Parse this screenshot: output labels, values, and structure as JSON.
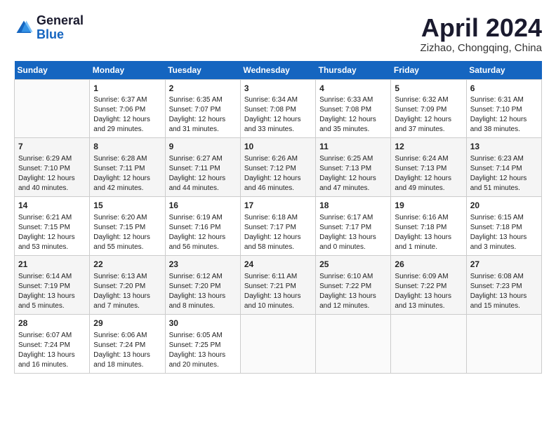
{
  "header": {
    "logo_general": "General",
    "logo_blue": "Blue",
    "title": "April 2024",
    "location": "Zizhao, Chongqing, China"
  },
  "calendar": {
    "days_of_week": [
      "Sunday",
      "Monday",
      "Tuesday",
      "Wednesday",
      "Thursday",
      "Friday",
      "Saturday"
    ],
    "weeks": [
      [
        {
          "day": "",
          "data": ""
        },
        {
          "day": "1",
          "data": "Sunrise: 6:37 AM\nSunset: 7:06 PM\nDaylight: 12 hours\nand 29 minutes."
        },
        {
          "day": "2",
          "data": "Sunrise: 6:35 AM\nSunset: 7:07 PM\nDaylight: 12 hours\nand 31 minutes."
        },
        {
          "day": "3",
          "data": "Sunrise: 6:34 AM\nSunset: 7:08 PM\nDaylight: 12 hours\nand 33 minutes."
        },
        {
          "day": "4",
          "data": "Sunrise: 6:33 AM\nSunset: 7:08 PM\nDaylight: 12 hours\nand 35 minutes."
        },
        {
          "day": "5",
          "data": "Sunrise: 6:32 AM\nSunset: 7:09 PM\nDaylight: 12 hours\nand 37 minutes."
        },
        {
          "day": "6",
          "data": "Sunrise: 6:31 AM\nSunset: 7:10 PM\nDaylight: 12 hours\nand 38 minutes."
        }
      ],
      [
        {
          "day": "7",
          "data": "Sunrise: 6:29 AM\nSunset: 7:10 PM\nDaylight: 12 hours\nand 40 minutes."
        },
        {
          "day": "8",
          "data": "Sunrise: 6:28 AM\nSunset: 7:11 PM\nDaylight: 12 hours\nand 42 minutes."
        },
        {
          "day": "9",
          "data": "Sunrise: 6:27 AM\nSunset: 7:11 PM\nDaylight: 12 hours\nand 44 minutes."
        },
        {
          "day": "10",
          "data": "Sunrise: 6:26 AM\nSunset: 7:12 PM\nDaylight: 12 hours\nand 46 minutes."
        },
        {
          "day": "11",
          "data": "Sunrise: 6:25 AM\nSunset: 7:13 PM\nDaylight: 12 hours\nand 47 minutes."
        },
        {
          "day": "12",
          "data": "Sunrise: 6:24 AM\nSunset: 7:13 PM\nDaylight: 12 hours\nand 49 minutes."
        },
        {
          "day": "13",
          "data": "Sunrise: 6:23 AM\nSunset: 7:14 PM\nDaylight: 12 hours\nand 51 minutes."
        }
      ],
      [
        {
          "day": "14",
          "data": "Sunrise: 6:21 AM\nSunset: 7:15 PM\nDaylight: 12 hours\nand 53 minutes."
        },
        {
          "day": "15",
          "data": "Sunrise: 6:20 AM\nSunset: 7:15 PM\nDaylight: 12 hours\nand 55 minutes."
        },
        {
          "day": "16",
          "data": "Sunrise: 6:19 AM\nSunset: 7:16 PM\nDaylight: 12 hours\nand 56 minutes."
        },
        {
          "day": "17",
          "data": "Sunrise: 6:18 AM\nSunset: 7:17 PM\nDaylight: 12 hours\nand 58 minutes."
        },
        {
          "day": "18",
          "data": "Sunrise: 6:17 AM\nSunset: 7:17 PM\nDaylight: 13 hours\nand 0 minutes."
        },
        {
          "day": "19",
          "data": "Sunrise: 6:16 AM\nSunset: 7:18 PM\nDaylight: 13 hours\nand 1 minute."
        },
        {
          "day": "20",
          "data": "Sunrise: 6:15 AM\nSunset: 7:18 PM\nDaylight: 13 hours\nand 3 minutes."
        }
      ],
      [
        {
          "day": "21",
          "data": "Sunrise: 6:14 AM\nSunset: 7:19 PM\nDaylight: 13 hours\nand 5 minutes."
        },
        {
          "day": "22",
          "data": "Sunrise: 6:13 AM\nSunset: 7:20 PM\nDaylight: 13 hours\nand 7 minutes."
        },
        {
          "day": "23",
          "data": "Sunrise: 6:12 AM\nSunset: 7:20 PM\nDaylight: 13 hours\nand 8 minutes."
        },
        {
          "day": "24",
          "data": "Sunrise: 6:11 AM\nSunset: 7:21 PM\nDaylight: 13 hours\nand 10 minutes."
        },
        {
          "day": "25",
          "data": "Sunrise: 6:10 AM\nSunset: 7:22 PM\nDaylight: 13 hours\nand 12 minutes."
        },
        {
          "day": "26",
          "data": "Sunrise: 6:09 AM\nSunset: 7:22 PM\nDaylight: 13 hours\nand 13 minutes."
        },
        {
          "day": "27",
          "data": "Sunrise: 6:08 AM\nSunset: 7:23 PM\nDaylight: 13 hours\nand 15 minutes."
        }
      ],
      [
        {
          "day": "28",
          "data": "Sunrise: 6:07 AM\nSunset: 7:24 PM\nDaylight: 13 hours\nand 16 minutes."
        },
        {
          "day": "29",
          "data": "Sunrise: 6:06 AM\nSunset: 7:24 PM\nDaylight: 13 hours\nand 18 minutes."
        },
        {
          "day": "30",
          "data": "Sunrise: 6:05 AM\nSunset: 7:25 PM\nDaylight: 13 hours\nand 20 minutes."
        },
        {
          "day": "",
          "data": ""
        },
        {
          "day": "",
          "data": ""
        },
        {
          "day": "",
          "data": ""
        },
        {
          "day": "",
          "data": ""
        }
      ]
    ]
  }
}
